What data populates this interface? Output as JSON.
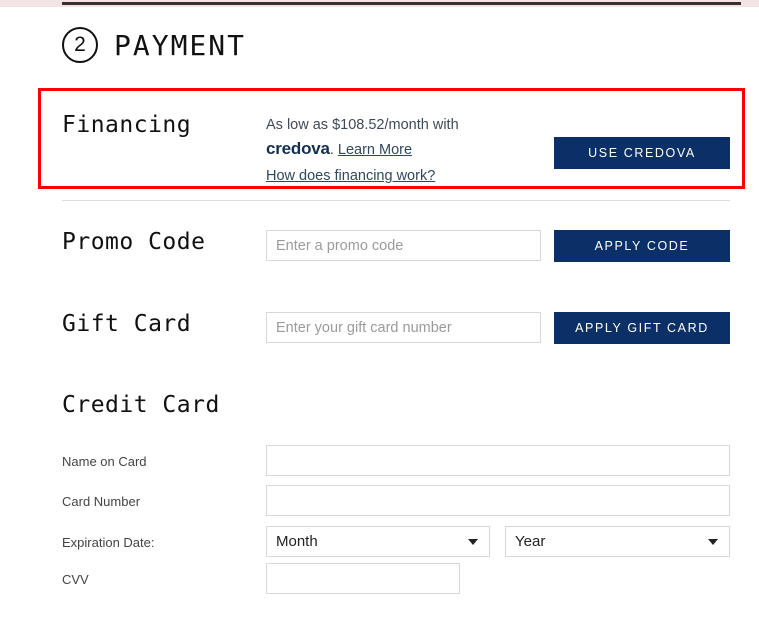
{
  "header": {
    "step_number": "2",
    "title": "PAYMENT"
  },
  "financing": {
    "label": "Financing",
    "offer_text": "As low as $108.52/month with",
    "provider": "credova",
    "provider_suffix": ".",
    "learn_more": "Learn More",
    "how_it_works": "How does financing work?",
    "button": "USE CREDOVA"
  },
  "promo": {
    "label": "Promo Code",
    "placeholder": "Enter a promo code",
    "value": "",
    "button": "APPLY CODE"
  },
  "gift_card": {
    "label": "Gift Card",
    "placeholder": "Enter your gift card number",
    "value": "",
    "button": "APPLY GIFT CARD"
  },
  "credit_card": {
    "label": "Credit Card",
    "fields": [
      {
        "label": "Name on Card",
        "value": "",
        "placeholder": ""
      },
      {
        "label": "Card Number",
        "value": "",
        "placeholder": ""
      },
      {
        "label": "Expiration Date:",
        "value": "",
        "placeholder": ""
      },
      {
        "label": "CVV",
        "value": "",
        "placeholder": ""
      }
    ],
    "expiration": {
      "month_selected": "Month",
      "year_selected": "Year"
    }
  },
  "colors": {
    "button_navy": "#0b3068",
    "highlight_red": "#ff0000",
    "link_navy": "#2f4760",
    "top_band_pink": "#f4e3e3"
  }
}
